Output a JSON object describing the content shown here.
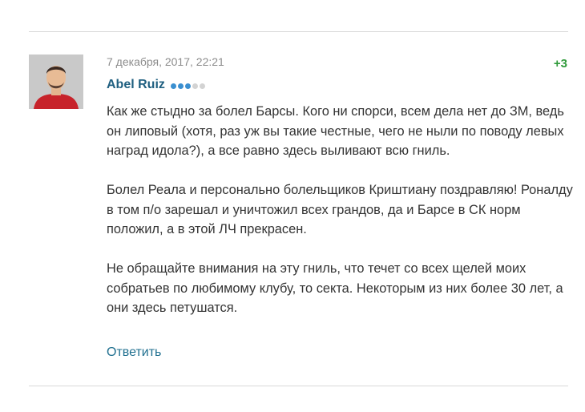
{
  "comment": {
    "date": "7 декабря, 2017, 22:21",
    "score": "+3",
    "author": "Abel Ruiz",
    "rating_dots": [
      true,
      true,
      true,
      false,
      false
    ],
    "paragraphs": [
      "Как же стыдно за болел Барсы. Кого ни спорси, всем дела нет до ЗМ, ведь он липовый (хотя, раз уж вы такие честные, чего не ныли по поводу левых наград идола?), а все равно здесь выливают всю гниль.",
      "Болел Реала и персонально болельщиков Криштиану поздравляю! Роналду в том п/о зарешал и уничтожил всех грандов, да и Барсе в СК норм положил, а в этой ЛЧ прекрасен.",
      "Не обращайте внимания на эту гниль, что течет со всех щелей моих собратьев по любимому клубу, то секта. Некоторым из них более 30 лет, а они здесь петушатся."
    ],
    "reply_label": "Ответить"
  },
  "colors": {
    "author": "#1f5f80",
    "score": "#2f9a3a",
    "rating_on": "#3a8fd0",
    "rating_off": "#d3d3d3",
    "link": "#1f6f8f"
  }
}
